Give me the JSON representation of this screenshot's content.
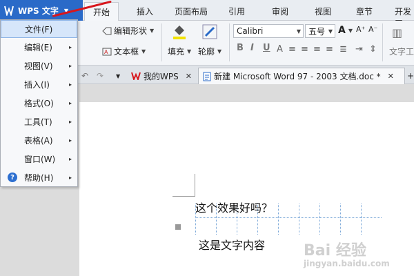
{
  "app": {
    "button_label": "WPS 文字"
  },
  "tabs": [
    "开始",
    "插入",
    "页面布局",
    "引用",
    "审阅",
    "视图",
    "章节",
    "开发工"
  ],
  "ribbon": {
    "edit_shape": "编辑形状",
    "textbox": "文本框",
    "fill": "填充",
    "outline": "轮廓",
    "font_name": "Calibri",
    "font_size": "五号",
    "text_tool": "文字工",
    "format_buttons": [
      "B",
      "I",
      "U",
      "A"
    ]
  },
  "doc_tabs": {
    "home_tab": "我的WPS",
    "active_doc": "新建 Microsoft Word 97 - 2003 文档.doc *"
  },
  "menu": {
    "items": [
      {
        "label": "文件(F)",
        "has_sub": false
      },
      {
        "label": "编辑(E)",
        "has_sub": true
      },
      {
        "label": "视图(V)",
        "has_sub": true
      },
      {
        "label": "插入(I)",
        "has_sub": true
      },
      {
        "label": "格式(O)",
        "has_sub": true
      },
      {
        "label": "工具(T)",
        "has_sub": true
      },
      {
        "label": "表格(A)",
        "has_sub": true
      },
      {
        "label": "窗口(W)",
        "has_sub": true
      },
      {
        "label": "帮助(H)",
        "has_sub": true
      }
    ],
    "submenu_arrow": "▸"
  },
  "document": {
    "line1": "这个效果好吗？",
    "line2": "这是文字内容"
  },
  "watermark": {
    "brand": "Bai 经验",
    "url": "jingyan.baidu.com"
  },
  "colors": {
    "accent": "#2a6ac8",
    "highlight": "#d6e6fa",
    "annotation": "#d8161c"
  }
}
